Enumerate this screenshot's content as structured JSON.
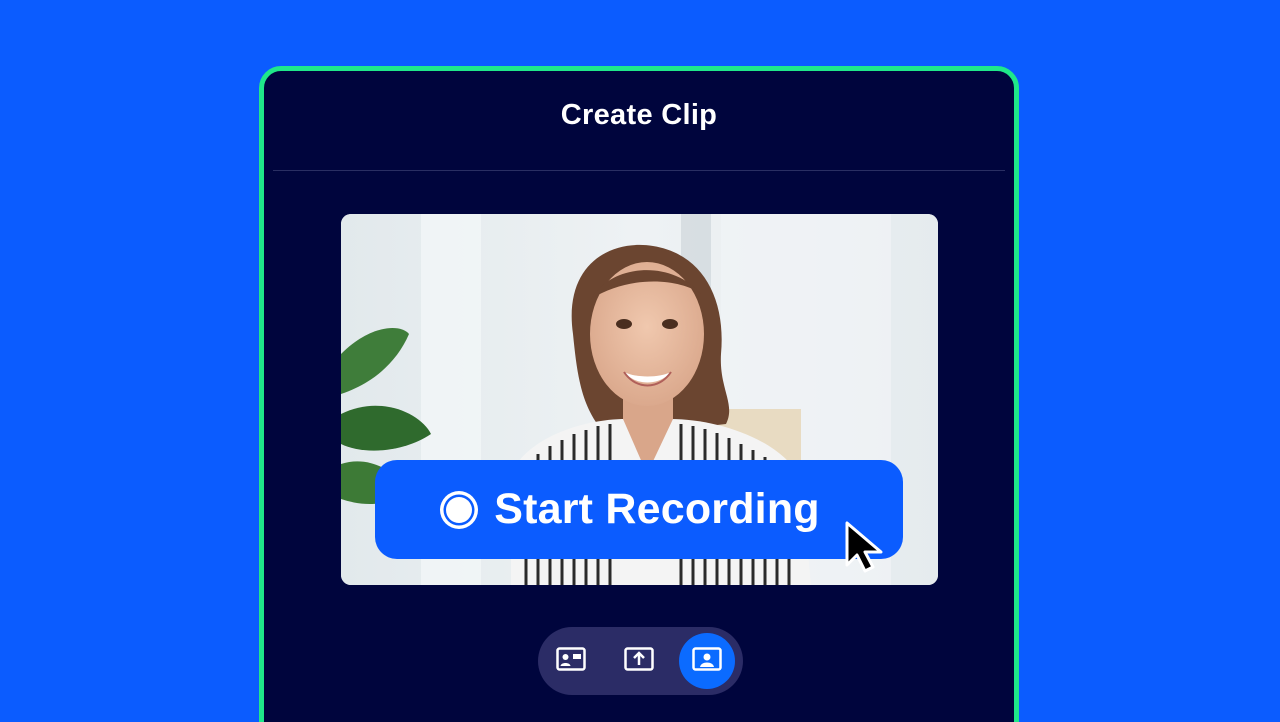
{
  "panel": {
    "title": "Create Clip"
  },
  "preview": {
    "record_button_label": "Start Recording"
  },
  "mode_bar": {
    "items": [
      {
        "icon": "video-card-icon",
        "active": false
      },
      {
        "icon": "upload-icon",
        "active": false
      },
      {
        "icon": "webcam-portrait-icon",
        "active": true
      }
    ]
  },
  "colors": {
    "background": "#0b5cff",
    "panel": "#00053d",
    "panel_border": "#1fe88a",
    "accent": "#0b5cff",
    "mode_bar": "#2b2c66"
  }
}
